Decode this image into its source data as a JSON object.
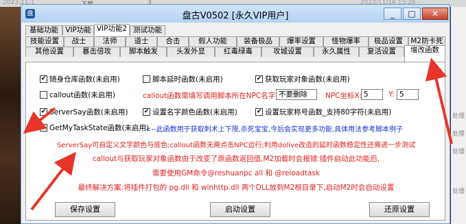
{
  "background": {
    "topbar_date_left": "2023-11-1",
    "topbar_file": "下载",
    "topbar_num": "3",
    "topbar_date_right": "2023/11/16 15:26",
    "right_labels": [
      "处理",
      "处理",
      "处理",
      "处理"
    ]
  },
  "window": {
    "title": "盘古V0502 [永久VIP用户]",
    "icon_label": "盘",
    "min_glyph": "_",
    "max_glyph": "□",
    "close_glyph": "✕"
  },
  "tabs": {
    "row1": [
      "基础功能",
      "VIP功能",
      "VIP功能2",
      "测试功能"
    ],
    "row2": [
      "技能设置",
      "战士",
      "法师",
      "道士",
      "合击",
      "假人功能",
      "装备极品",
      "爆率设置",
      "怪物爆率",
      "极品设置",
      "M2防卡死"
    ],
    "row3": [
      "其他设置",
      "暴击倍攻",
      "脚本触发",
      "头发外显",
      "红毒绿毒",
      "攻城设置",
      "永久属性",
      "复活设置",
      "增改函数"
    ]
  },
  "panel": {
    "warehouse": {
      "label": "随身仓库函数(未启用)",
      "checked": true
    },
    "script_delay": {
      "label": "脚本延时函数(未启用)",
      "checked": false
    },
    "get_player_obj": {
      "label": "获取玩家对象函数(未启用)",
      "checked": true
    },
    "callout": {
      "label": "callout函数(未启用)",
      "checked": false
    },
    "callout_hint": "callout函数需填写调用脚本所在NPC名字",
    "npc_name_value": "不要删除",
    "npc_coord_label": "NPC坐标X:",
    "npc_x_value": "5",
    "npc_y_label": "Y:",
    "npc_y_value": "5",
    "serversay": {
      "label": "ServerSay函数(未启用)",
      "checked": true
    },
    "name_color": {
      "label": "设置名字颜色函数(未启用)",
      "checked": true
    },
    "player_title": {
      "label": "设置玩家称号函数_支持80字符(未启用)",
      "checked": true
    },
    "task_state": {
      "label": "GetMyTaskState函数(未启用)",
      "checked": false
    },
    "task_state_hint": "<--此函数用于获取刺术上下限,杀死宝宝,今后会实现更多功能,具体用法参考脚本例子",
    "msg1": "ServerSay可自定义文字颜色与底色;callout函数无需点击NPC运行;利用dolive改造的延时函数稳定性还需进一步测试",
    "msg2": "callout与获取玩家对象函数由于改变了原函数返回值,M2加载时会报错:插件启动此功能后,",
    "msg3": "需要使用GM命令@reshuanpc all 和 @reloadtask",
    "msg4": "最终解决方案:将插件打包的 pg.dll 和 winhttp.dll 两个DLL放到M2根目录下,启动M2时会自动设置"
  },
  "buttons": {
    "save": "保存设置",
    "start": "启动设置",
    "restore": "还原设置"
  },
  "colors": {
    "title_bar": "#b6d2f3",
    "hint_red": "#e02020",
    "hint_blue": "#1a2fd6",
    "annotation_arrow": "#e8342a"
  }
}
